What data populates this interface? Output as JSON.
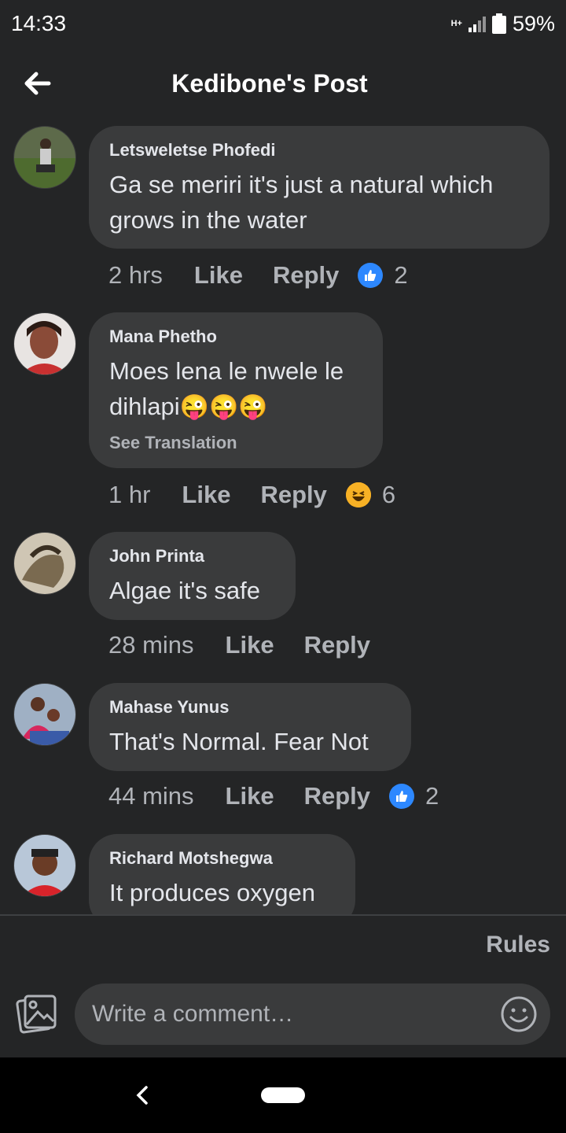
{
  "status_bar": {
    "time": "14:33",
    "network": "H+",
    "battery": "59%"
  },
  "header": {
    "title": "Kedibone's Post",
    "back_icon": "arrow-left-icon"
  },
  "comments": [
    {
      "author": "Letsweletse Phofedi",
      "text": "Ga se meriri it's just a natural which grows in the water",
      "time": "2 hrs",
      "like_label": "Like",
      "reply_label": "Reply",
      "reaction": "like",
      "reaction_count": "2"
    },
    {
      "author": "Mana Phetho",
      "text": "Moes lena le nwele le dihlapi",
      "emoji": "😜😜😜",
      "see_translation": "See Translation",
      "time": "1 hr",
      "like_label": "Like",
      "reply_label": "Reply",
      "reaction": "haha",
      "reaction_count": "6"
    },
    {
      "author": "John Printa",
      "text": "Algae it's safe",
      "time": "28 mins",
      "like_label": "Like",
      "reply_label": "Reply"
    },
    {
      "author": "Mahase Yunus",
      "text": "That's Normal. Fear Not",
      "time": "44 mins",
      "like_label": "Like",
      "reply_label": "Reply",
      "reaction": "like",
      "reaction_count": "2"
    },
    {
      "author": "Richard Motshegwa",
      "text": "It produces oxygen"
    }
  ],
  "rules_label": "Rules",
  "composer": {
    "placeholder": "Write a comment…"
  },
  "colors": {
    "background": "#242526",
    "bubble": "#3a3b3c",
    "like_blue": "#2d88ff",
    "haha_yellow": "#f7b125"
  }
}
